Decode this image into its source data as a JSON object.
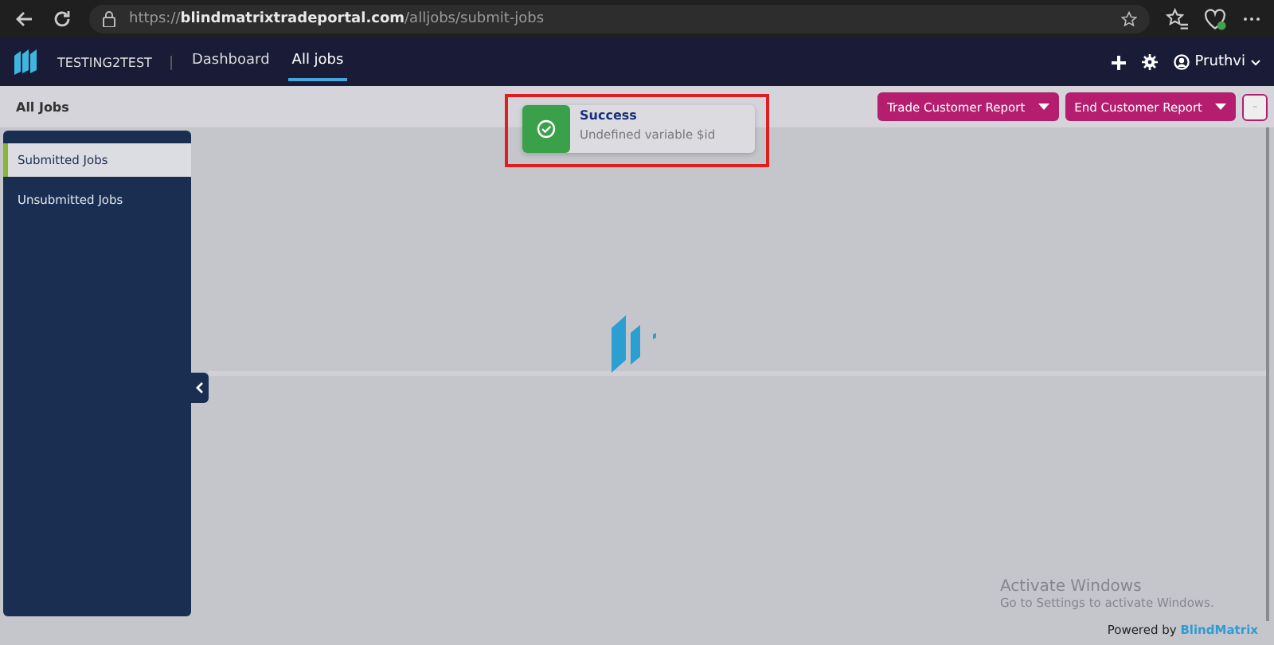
{
  "browser": {
    "url": "https://**blindmatrixtradeportal.com**/alljobs/submit-jobs"
  },
  "app": {
    "company": "TESTING2TEST",
    "nav": [
      {
        "label": "Dashboard",
        "selected": false
      },
      {
        "label": "All jobs",
        "selected": true
      }
    ],
    "user": "Pruthvi"
  },
  "page": {
    "title": "All Jobs",
    "buttons": [
      {
        "label": "Trade Customer Report"
      },
      {
        "label": "End Customer Report"
      }
    ]
  },
  "sidebar": {
    "items": [
      {
        "label": "Submitted Jobs",
        "selected": true
      },
      {
        "label": "Unsubmitted Jobs",
        "selected": false
      }
    ]
  },
  "toast": {
    "title": "Success",
    "message": "Undefined variable $id"
  },
  "os_notice": {
    "title": "Activate Windows",
    "message": "Go to Settings to activate Windows."
  },
  "footer": {
    "prefix": "Powered by",
    "brand": "BlindMatrix"
  }
}
